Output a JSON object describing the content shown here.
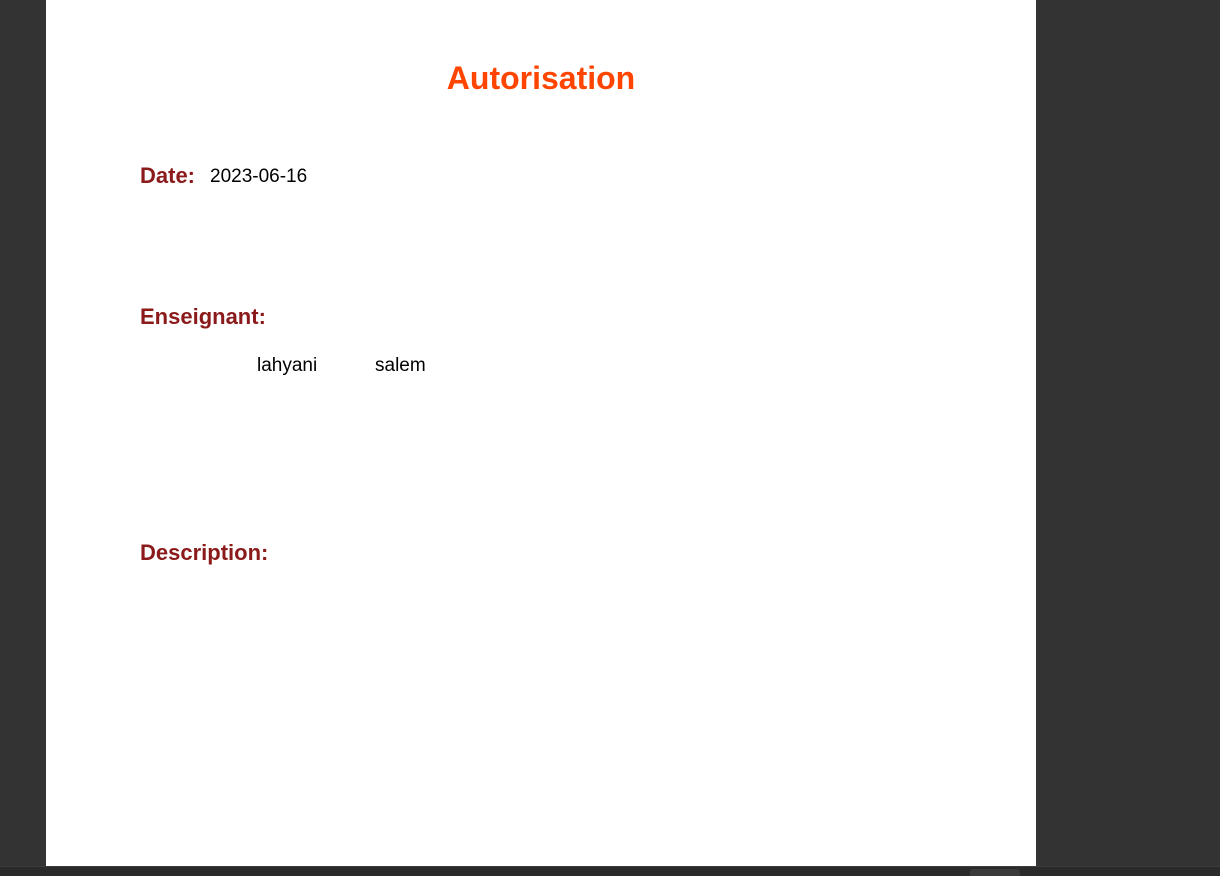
{
  "document": {
    "title": "Autorisation",
    "date_label": "Date:",
    "date_value": "2023-06-16",
    "enseignant_label": "Enseignant:",
    "enseignant_nom": "lahyani",
    "enseignant_prenom": "salem",
    "description_label": "Description:",
    "description_value": ""
  },
  "colors": {
    "title": "#ff4500",
    "label": "#8b1a1a",
    "viewer_background": "#333333",
    "page_background": "#ffffff"
  }
}
